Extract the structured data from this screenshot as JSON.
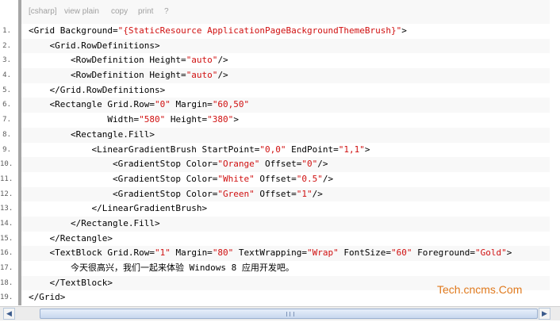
{
  "toolbar": {
    "lang": "[csharp]",
    "view_plain": "view plain",
    "copy": "copy",
    "print": "print",
    "help": "?"
  },
  "lines": [
    {
      "num": "1.",
      "parts": [
        [
          "",
          "<Grid Background="
        ],
        [
          "s",
          "\"{StaticResource ApplicationPageBackgroundThemeBrush}\""
        ],
        [
          "",
          ">"
        ]
      ]
    },
    {
      "num": "2.",
      "parts": [
        [
          "",
          "    <Grid.RowDefinitions>"
        ]
      ]
    },
    {
      "num": "3.",
      "parts": [
        [
          "",
          "        <RowDefinition Height="
        ],
        [
          "s",
          "\"auto\""
        ],
        [
          "",
          "/>"
        ]
      ]
    },
    {
      "num": "4.",
      "parts": [
        [
          "",
          "        <RowDefinition Height="
        ],
        [
          "s",
          "\"auto\""
        ],
        [
          "",
          "/>"
        ]
      ]
    },
    {
      "num": "5.",
      "parts": [
        [
          "",
          "    </Grid.RowDefinitions>"
        ]
      ]
    },
    {
      "num": "6.",
      "parts": [
        [
          "",
          "    <Rectangle Grid.Row="
        ],
        [
          "s",
          "\"0\""
        ],
        [
          "",
          " Margin="
        ],
        [
          "s",
          "\"60,50\""
        ]
      ]
    },
    {
      "num": "7.",
      "parts": [
        [
          "",
          "               Width="
        ],
        [
          "s",
          "\"580\""
        ],
        [
          "",
          " Height="
        ],
        [
          "s",
          "\"380\""
        ],
        [
          "",
          ">"
        ]
      ]
    },
    {
      "num": "8.",
      "parts": [
        [
          "",
          "        <Rectangle.Fill>"
        ]
      ]
    },
    {
      "num": "9.",
      "parts": [
        [
          "",
          "            <LinearGradientBrush StartPoint="
        ],
        [
          "s",
          "\"0,0\""
        ],
        [
          "",
          " EndPoint="
        ],
        [
          "s",
          "\"1,1\""
        ],
        [
          "",
          ">"
        ]
      ]
    },
    {
      "num": "10.",
      "parts": [
        [
          "",
          "                <GradientStop Color="
        ],
        [
          "s",
          "\"Orange\""
        ],
        [
          "",
          " Offset="
        ],
        [
          "s",
          "\"0\""
        ],
        [
          "",
          "/>"
        ]
      ]
    },
    {
      "num": "11.",
      "parts": [
        [
          "",
          "                <GradientStop Color="
        ],
        [
          "s",
          "\"White\""
        ],
        [
          "",
          " Offset="
        ],
        [
          "s",
          "\"0.5\""
        ],
        [
          "",
          "/>"
        ]
      ]
    },
    {
      "num": "12.",
      "parts": [
        [
          "",
          "                <GradientStop Color="
        ],
        [
          "s",
          "\"Green\""
        ],
        [
          "",
          " Offset="
        ],
        [
          "s",
          "\"1\""
        ],
        [
          "",
          "/>"
        ]
      ]
    },
    {
      "num": "13.",
      "parts": [
        [
          "",
          "            </LinearGradientBrush>"
        ]
      ]
    },
    {
      "num": "14.",
      "parts": [
        [
          "",
          "        </Rectangle.Fill>"
        ]
      ]
    },
    {
      "num": "15.",
      "parts": [
        [
          "",
          "    </Rectangle>"
        ]
      ]
    },
    {
      "num": "16.",
      "parts": [
        [
          "",
          "    <TextBlock Grid.Row="
        ],
        [
          "s",
          "\"1\""
        ],
        [
          "",
          " Margin="
        ],
        [
          "s",
          "\"80\""
        ],
        [
          "",
          " TextWrapping="
        ],
        [
          "s",
          "\"Wrap\""
        ],
        [
          "",
          " FontSize="
        ],
        [
          "s",
          "\"60\""
        ],
        [
          "",
          " Foreground="
        ],
        [
          "s",
          "\"Gold\""
        ],
        [
          "",
          ">"
        ]
      ]
    },
    {
      "num": "17.",
      "parts": [
        [
          "",
          "        今天很高兴，我们一起来体验 Windows 8 应用开发吧。"
        ]
      ]
    },
    {
      "num": "18.",
      "parts": [
        [
          "",
          "    </TextBlock>"
        ]
      ]
    },
    {
      "num": "19.",
      "parts": [
        [
          "",
          "</Grid>"
        ]
      ]
    }
  ],
  "watermark": "Tech.cncms.Com",
  "scrollbar": {
    "left_arrow": "◀",
    "right_arrow": "▶"
  },
  "colors": {
    "string": "#d01010",
    "watermark": "#e07a1e",
    "gutter_bar": "#a6a6a6"
  }
}
